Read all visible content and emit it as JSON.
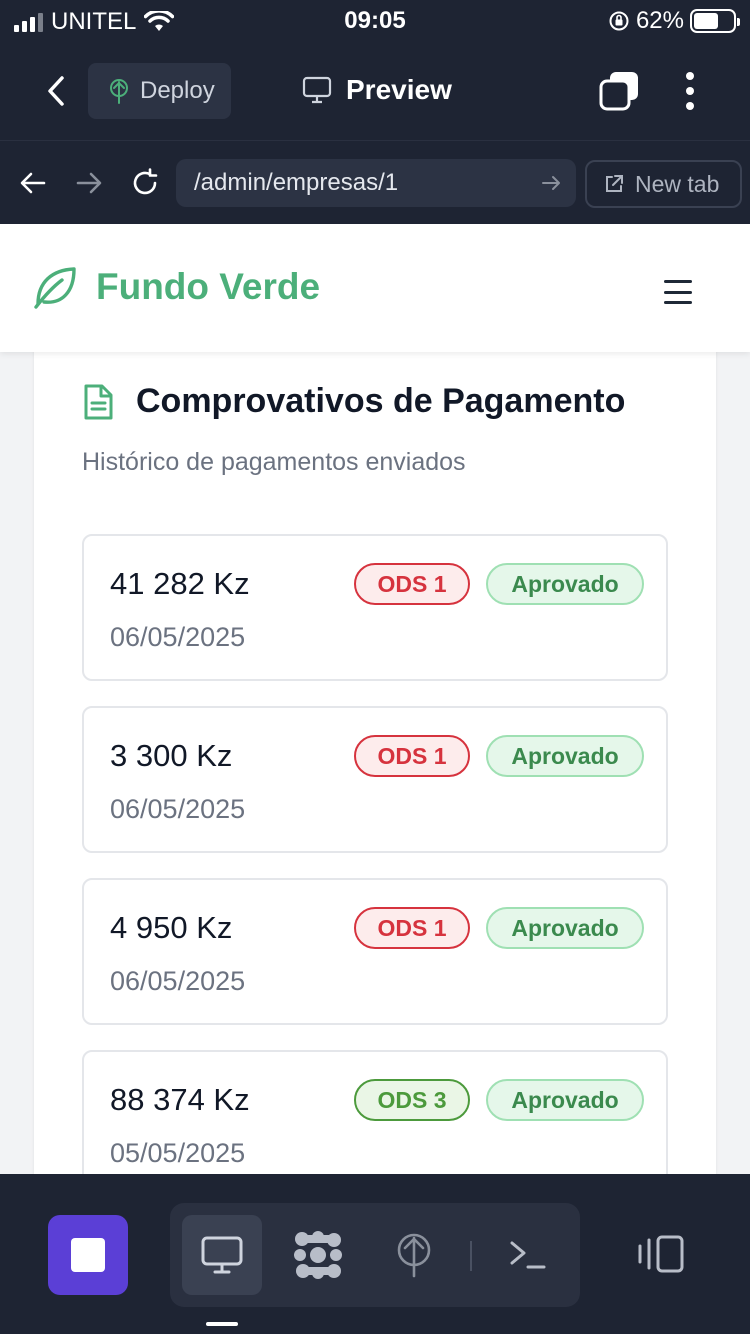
{
  "status_bar": {
    "carrier": "UNITEL",
    "time": "09:05",
    "battery_percent": "62%",
    "battery_level": 0.62,
    "signal_bars": 3
  },
  "app_bar": {
    "deploy_label": "Deploy",
    "preview_label": "Preview"
  },
  "browser": {
    "url": "/admin/empresas/1",
    "new_tab_label": "New tab"
  },
  "site": {
    "brand_name": "Fundo Verde",
    "brand_color": "#4caf7a"
  },
  "section": {
    "title": "Comprovativos de Pagamento",
    "subtitle": "Histórico de pagamentos enviados"
  },
  "payments": [
    {
      "amount": "41 282 Kz",
      "date": "06/05/2025",
      "ods": "ODS 1",
      "ods_color": "red",
      "status": "Aprovado"
    },
    {
      "amount": "3 300 Kz",
      "date": "06/05/2025",
      "ods": "ODS 1",
      "ods_color": "red",
      "status": "Aprovado"
    },
    {
      "amount": "4 950 Kz",
      "date": "06/05/2025",
      "ods": "ODS 1",
      "ods_color": "red",
      "status": "Aprovado"
    },
    {
      "amount": "88 374 Kz",
      "date": "05/05/2025",
      "ods": "ODS 3",
      "ods_color": "green",
      "status": "Aprovado"
    }
  ],
  "colors": {
    "chrome_bg": "#1e2433",
    "stop_button": "#5b3fd6",
    "ods1": "#d6333e",
    "ods3": "#4c9a3c",
    "approved": "#3b8a4e"
  },
  "icons": {
    "toolbar": [
      "monitor-icon",
      "puzzle-icon",
      "deploy-icon",
      "terminal-icon"
    ]
  }
}
